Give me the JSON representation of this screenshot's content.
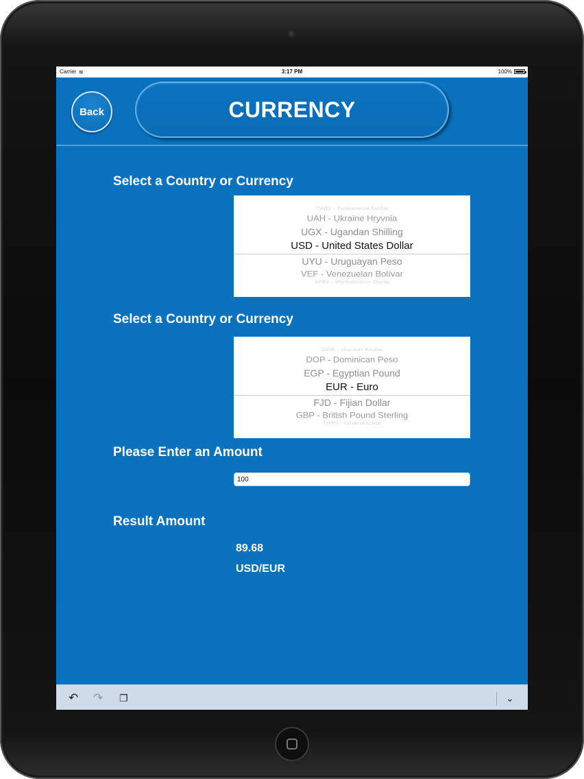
{
  "statusbar": {
    "carrier": "Carrier",
    "time": "3:17 PM",
    "battery": "100%"
  },
  "header": {
    "back_label": "Back",
    "title": "CURRENCY"
  },
  "from_section": {
    "label": "Select a Country or Currency",
    "options": [
      "TWD - Taiwanese Dollar",
      "UAH - Ukraine Hryvnia",
      "UGX - Ugandan Shilling",
      "USD - United States Dollar",
      "UYU - Uruguayan Peso",
      "VEF - Venezuelan Bolívar",
      "VND - Vietnamese Dong"
    ],
    "selected": "USD - United States Dollar"
  },
  "to_section": {
    "label": "Select a Country or Currency",
    "options": [
      "DKK - Danish Krone",
      "DOP - Dominican Peso",
      "EGP - Egyptian Pound",
      "EUR - Euro",
      "FJD - Fijian Dollar",
      "GBP - British Pound Sterling",
      "GHS - Ghana Cedi"
    ],
    "selected": "EUR - Euro"
  },
  "amount": {
    "label": "Please Enter an Amount",
    "value": "100"
  },
  "result": {
    "label": "Result Amount",
    "value": "89.68",
    "pair": "USD/EUR"
  },
  "toolbar": {
    "icons": [
      "undo-icon",
      "redo-icon",
      "clipboard-icon",
      "chevron-down-icon"
    ]
  },
  "colors": {
    "background": "#0a71bd",
    "text": "#ffffff",
    "toolbar": "#cfdbe8"
  }
}
